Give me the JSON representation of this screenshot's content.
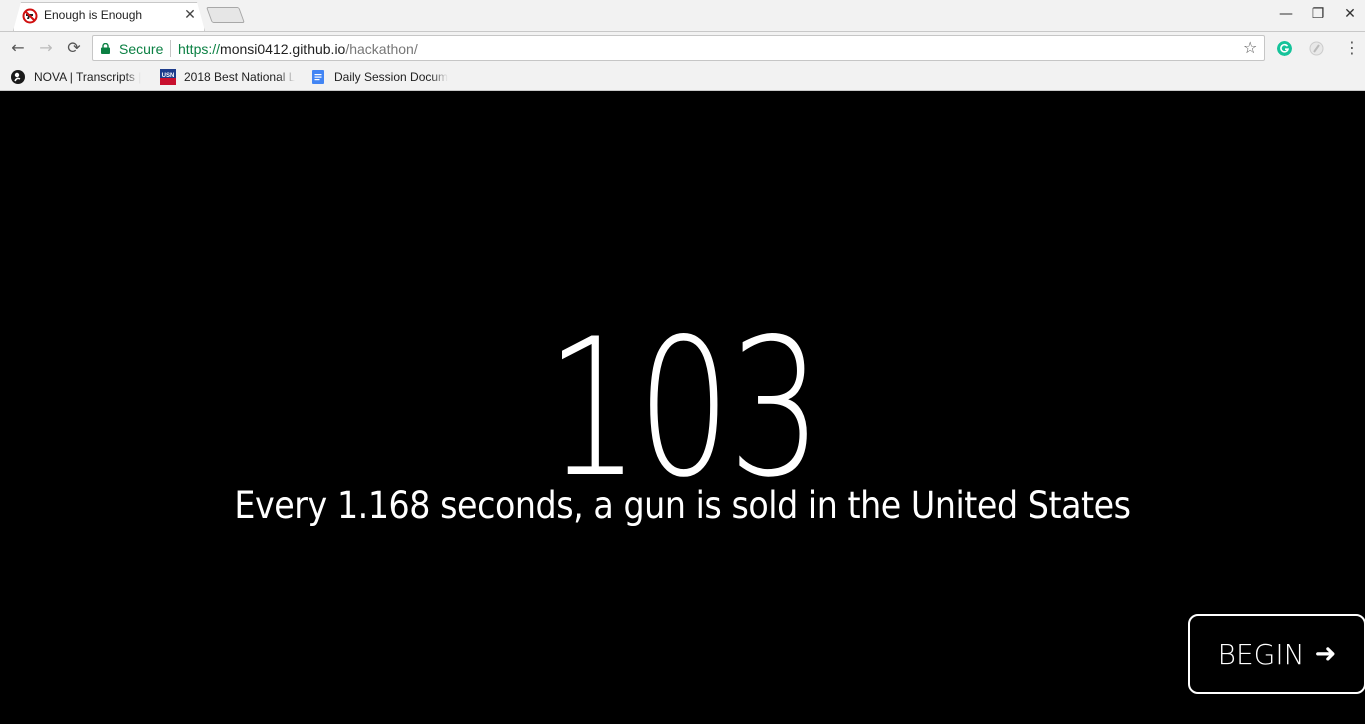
{
  "browser": {
    "tab": {
      "title": "Enough is Enough",
      "close": "✕"
    },
    "window_controls": {
      "minimize": "—",
      "restore": "❐",
      "close": "✕"
    },
    "nav": {
      "back": "←",
      "forward": "→",
      "reload": "⟳"
    },
    "omnibox": {
      "secure_label": "Secure",
      "scheme": "https://",
      "host": "monsi0412.github.io",
      "path": "/hackathon/",
      "star": "☆"
    },
    "menu": "⋮",
    "bookmarks": [
      {
        "label": "NOVA | Transcripts |",
        "icon": "pbs-icon"
      },
      {
        "label": "2018 Best National L",
        "icon": "usnews-icon"
      },
      {
        "label": "Daily Session Docum",
        "icon": "google-docs-icon"
      }
    ]
  },
  "page": {
    "counter": "103",
    "caption": "Every 1.168 seconds, a gun is sold in the United States",
    "begin_label": "BEGIN",
    "begin_arrow": "➜"
  },
  "colors": {
    "background": "#000000",
    "text": "#ffffff",
    "secure_green": "#0b8043"
  }
}
